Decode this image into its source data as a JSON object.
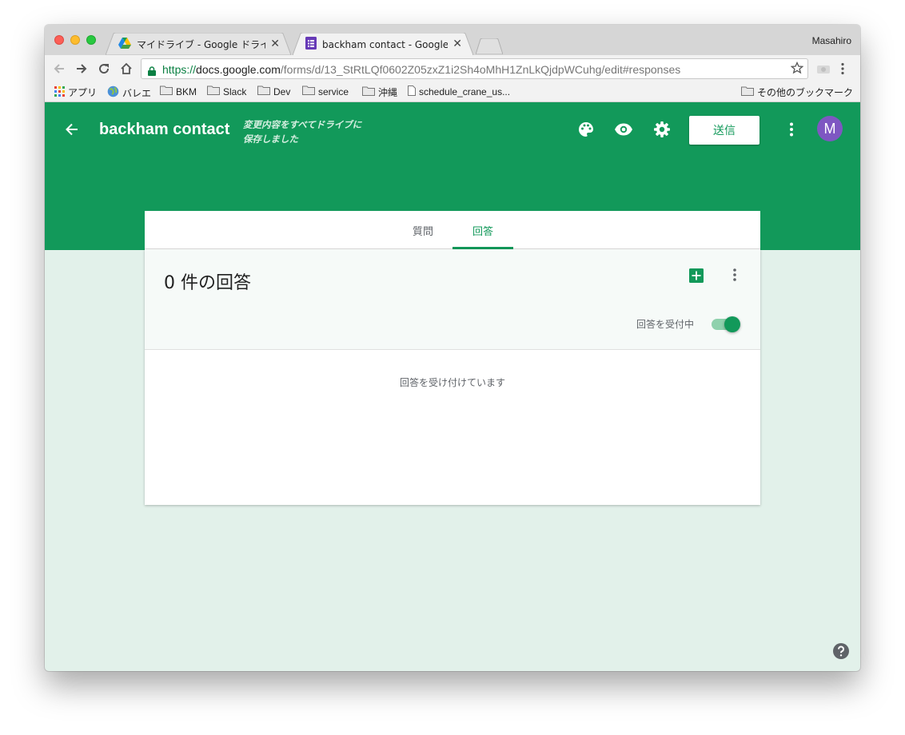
{
  "browser": {
    "profile_name": "Masahiro",
    "tabs": [
      {
        "label": "マイドライブ - Google ドライブ",
        "icon": "google-drive-icon",
        "active": false
      },
      {
        "label": "backham contact - Google フォ",
        "icon": "google-forms-icon",
        "active": true
      }
    ],
    "url": {
      "scheme": "https://",
      "host": "docs.google.com",
      "path": "/forms/d/13_StRtLQf0602Z05zxZ1i2Sh4oMhH1ZnLkQjdpWCuhg/edit#responses"
    },
    "bookmarks": [
      {
        "label": "アプリ",
        "icon": "apps-grid-icon"
      },
      {
        "label": "バレエ",
        "icon": "globe-icon"
      },
      {
        "label": "BKM",
        "icon": "folder-icon"
      },
      {
        "label": "Slack",
        "icon": "folder-icon"
      },
      {
        "label": "Dev",
        "icon": "folder-icon"
      },
      {
        "label": "service",
        "icon": "folder-icon"
      },
      {
        "label": "沖縄",
        "icon": "folder-icon"
      },
      {
        "label": "schedule_crane_us...",
        "icon": "page-icon"
      }
    ],
    "other_bookmarks": "その他のブックマーク"
  },
  "form": {
    "title": "backham contact",
    "save_status_line1": "変更内容をすべてドライブに",
    "save_status_line2": "保存しました",
    "send_label": "送信",
    "avatar_letter": "M",
    "tabs": [
      {
        "label": "質問",
        "active": false
      },
      {
        "label": "回答",
        "active": true
      }
    ],
    "responses": {
      "count_title": "0 件の回答",
      "accepting_toggle_label": "回答を受付中",
      "accepting_toggle_on": true,
      "status_message": "回答を受け付けています"
    }
  },
  "colors": {
    "brand_green": "#12995a",
    "page_background": "#e2f1ea",
    "avatar_purple": "#7e57c2"
  }
}
